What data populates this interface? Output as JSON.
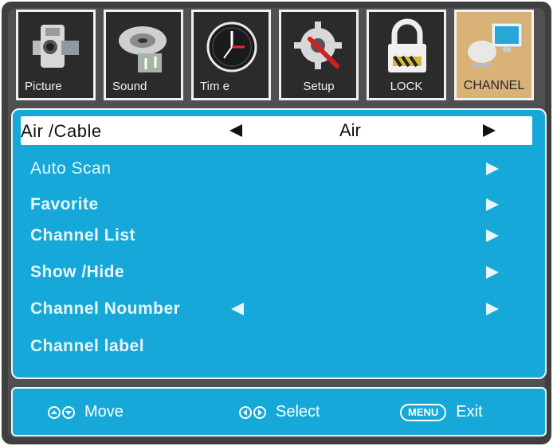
{
  "tabs": [
    {
      "label": "Picture",
      "icon": "camera-icon"
    },
    {
      "label": "Sound",
      "icon": "disc-icon"
    },
    {
      "label": "Tim e",
      "icon": "clock-icon"
    },
    {
      "label": "Setup",
      "icon": "gear-icon"
    },
    {
      "label": "LOCK",
      "icon": "lock-icon"
    },
    {
      "label": "CHANNEL",
      "icon": "satellite-dish-icon"
    }
  ],
  "menu": {
    "air_cable": {
      "label": "Air /Cable",
      "value": "Air"
    },
    "items": [
      {
        "label": "Auto  Scan"
      },
      {
        "label": "Favorite"
      },
      {
        "label": "Channel List"
      },
      {
        "label": "Show /Hide"
      },
      {
        "label": "Channel Noumber"
      },
      {
        "label": "Channel label"
      }
    ]
  },
  "footer": {
    "move": "Move",
    "select": "Select",
    "menu_key": "MENU",
    "exit": "Exit"
  },
  "colors": {
    "panel": "#16a8d8",
    "active_tab": "#d8b277",
    "frame": "#3f3f40"
  }
}
